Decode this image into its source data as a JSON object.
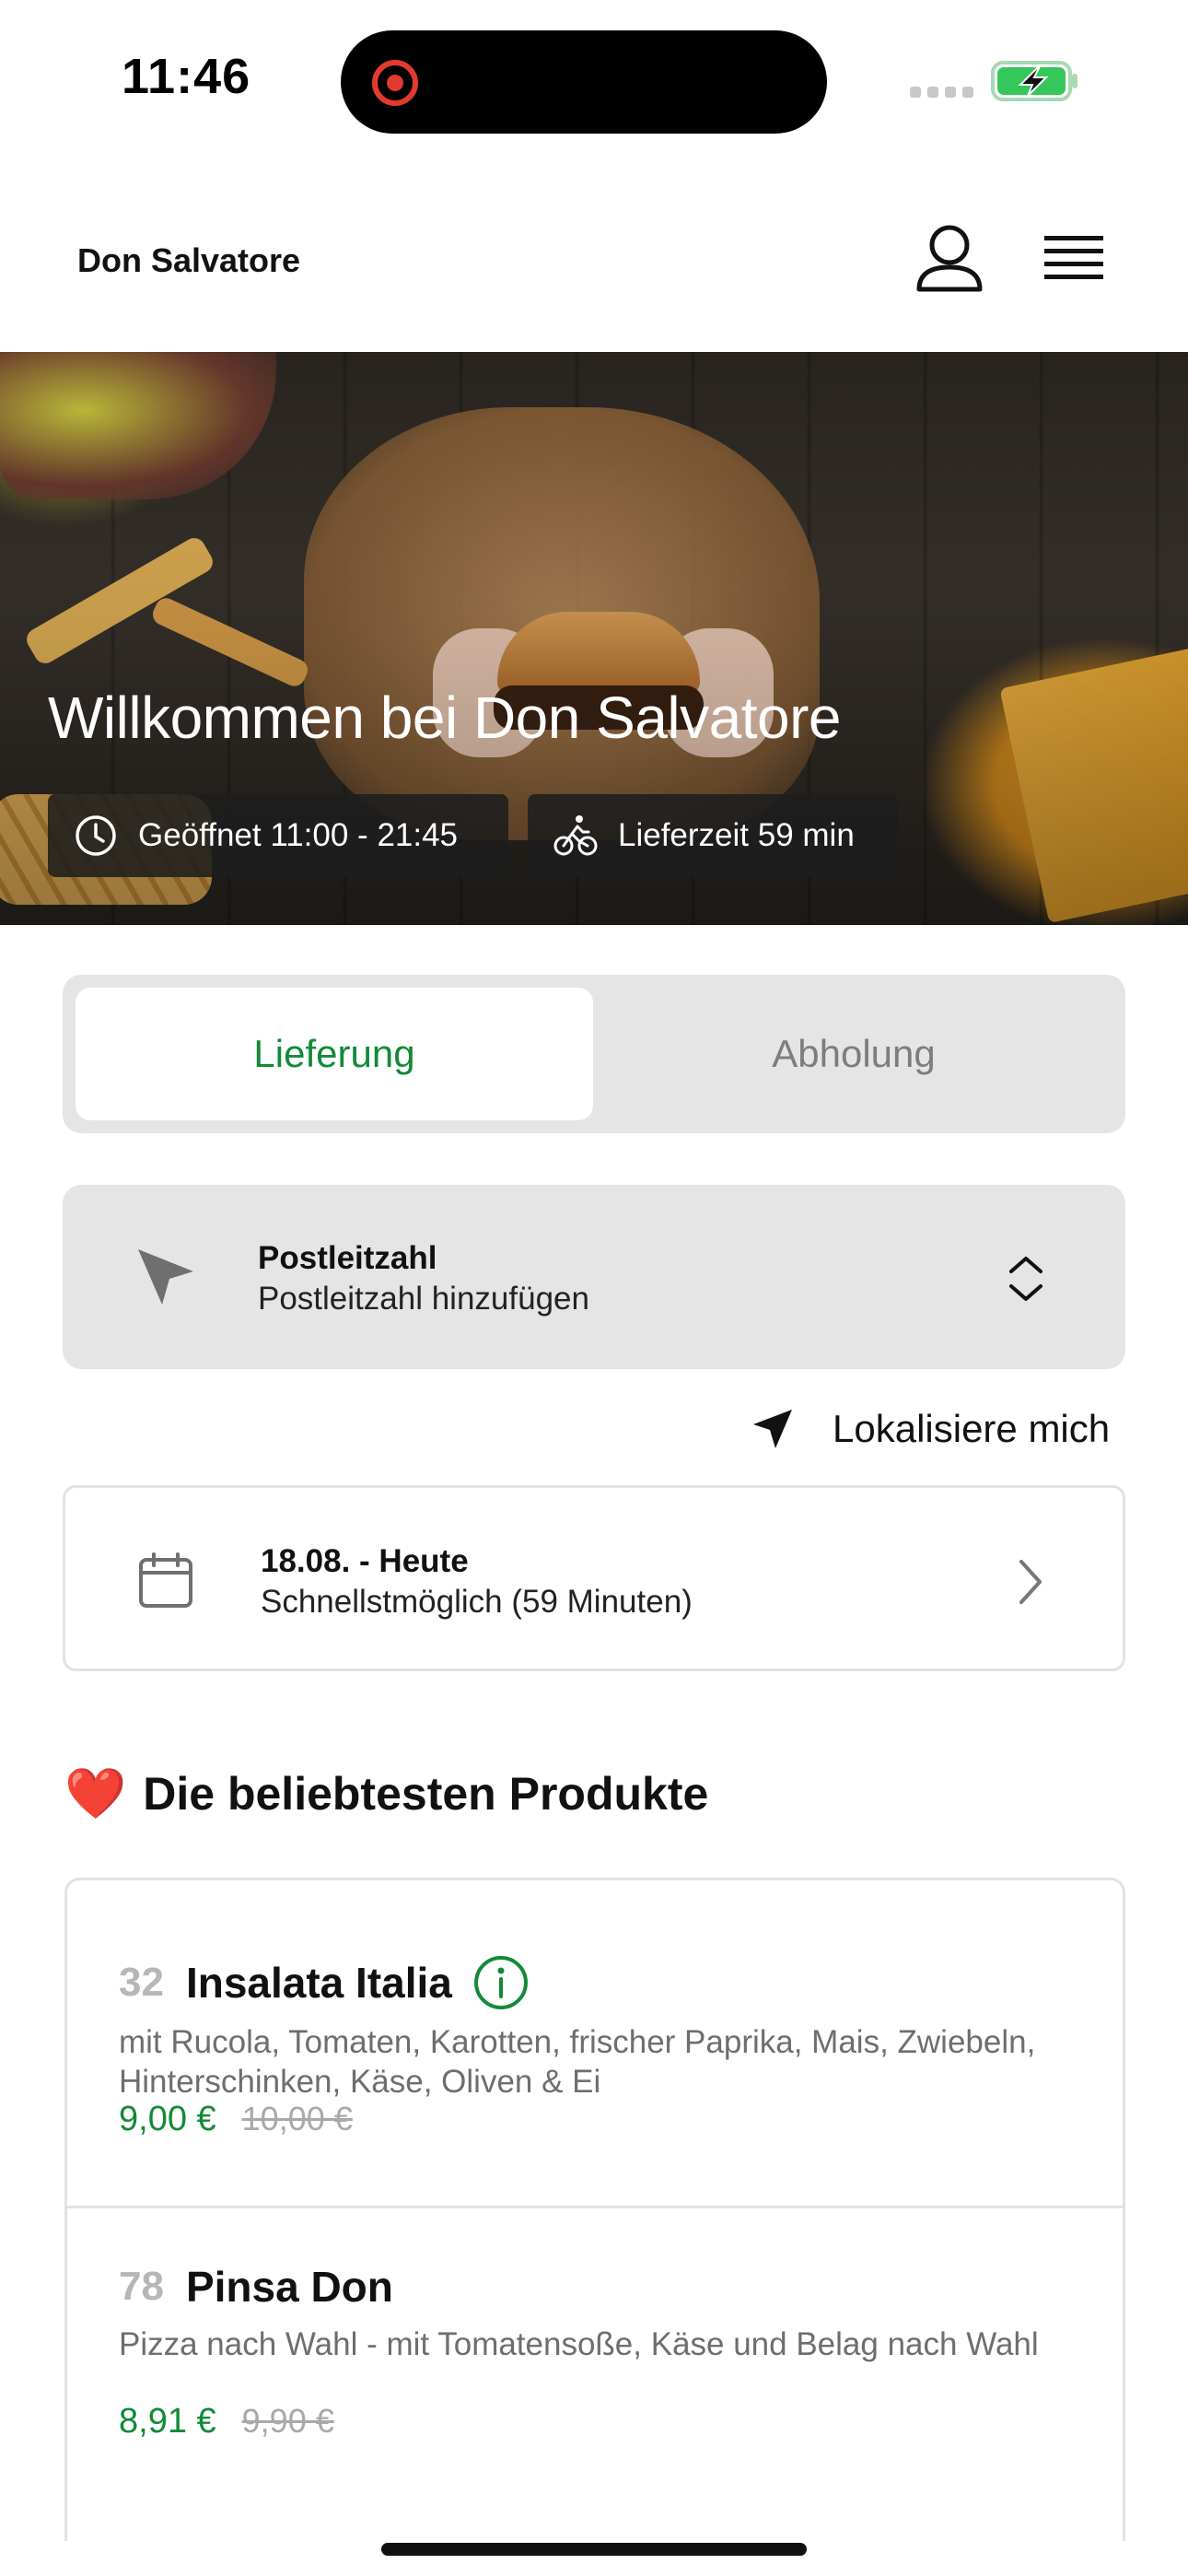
{
  "status_bar": {
    "time": "11:46",
    "recording": true,
    "battery_state": "charging",
    "battery_color": "#35c759"
  },
  "header": {
    "brand": "Don Salvatore",
    "user_icon": "user-icon",
    "menu_icon": "menu-icon"
  },
  "hero": {
    "title": "Willkommen bei Don Salvatore",
    "open_badge": "Geöffnet 11:00 - 21:45",
    "delivery_badge": "Lieferzeit 59 min"
  },
  "order_mode": {
    "options": [
      "Lieferung",
      "Abholung"
    ],
    "selected": "Lieferung",
    "accent_color": "#128a37"
  },
  "zip": {
    "title": "Postleitzahl",
    "placeholder": "Postleitzahl hinzufügen"
  },
  "locate": {
    "label": "Lokalisiere mich"
  },
  "date": {
    "title": "18.08. - Heute",
    "subtitle": "Schnellstmöglich (59 Minuten)"
  },
  "popular": {
    "title": "Die beliebtesten Produkte",
    "emoji": "❤️",
    "products": [
      {
        "number": "32",
        "name": "Insalata Italia",
        "has_info": true,
        "description": "mit Rucola, Tomaten, Karotten, frischer Paprika, Mais, Zwiebeln, Hinterschinken, Käse, Oliven & Ei",
        "price": "9,00 €",
        "old_price": "10,00 €"
      },
      {
        "number": "78",
        "name": "Pinsa Don",
        "has_info": false,
        "description": "Pizza nach Wahl - mit Tomatensoße, Käse und Belag nach Wahl",
        "price": "8,91 €",
        "old_price": "9,90 €"
      }
    ]
  }
}
